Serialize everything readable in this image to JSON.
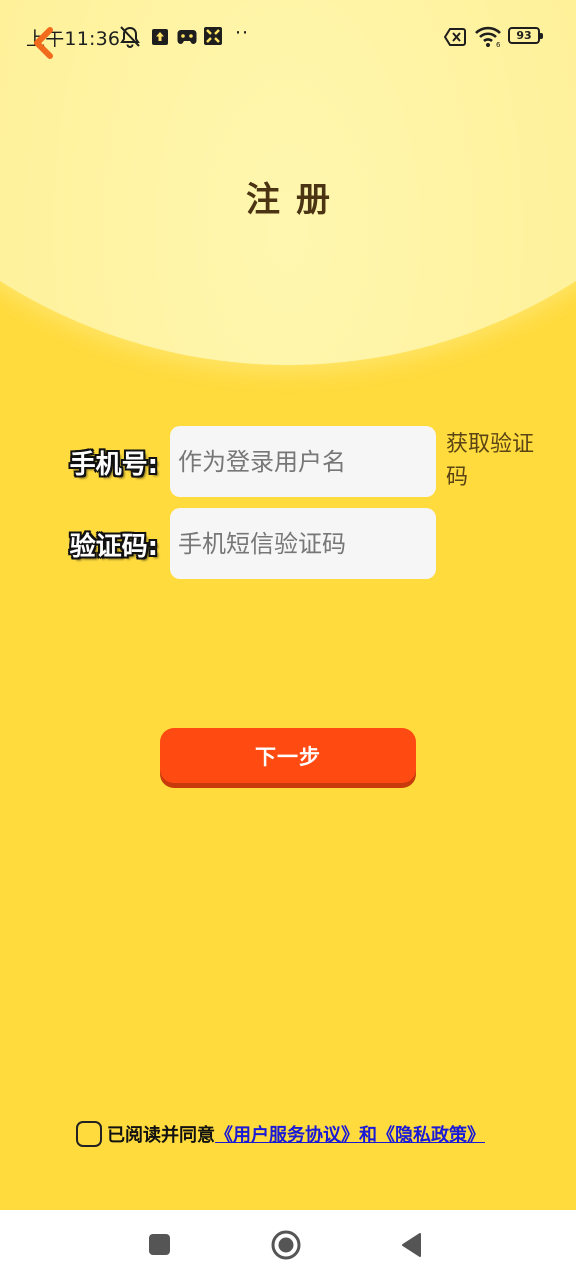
{
  "status_bar": {
    "time": "上午11:36",
    "battery": "93",
    "icons": [
      "mute-icon",
      "upload-icon",
      "gamepad-icon",
      "app-icon",
      "more-dots-icon",
      "sim-x-icon",
      "wifi-icon",
      "battery-icon"
    ],
    "dots": "··"
  },
  "header": {
    "title": "注册"
  },
  "form": {
    "phone_label": "手机号:",
    "phone_placeholder": "作为登录用户名",
    "get_code_label": "获取验证码",
    "code_label": "验证码:",
    "code_placeholder": "手机短信验证码"
  },
  "actions": {
    "next_label": "下一步"
  },
  "agreement": {
    "prefix": "已阅读并同意",
    "service_link": "《用户服务协议》",
    "and": "和",
    "privacy_link": "《隐私政策》"
  },
  "colors": {
    "background": "#FFDB3D",
    "button": "#FF4A12",
    "link": "#1a1ad6",
    "back_arrow": "#F26A1B"
  }
}
